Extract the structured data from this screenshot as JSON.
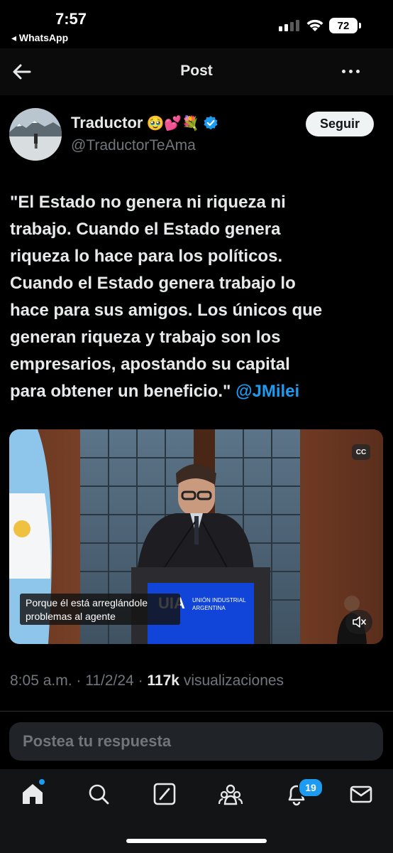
{
  "status_bar": {
    "time": "7:57",
    "back_app": "◂ WhatsApp",
    "battery": "72"
  },
  "header": {
    "title": "Post"
  },
  "author": {
    "name": "Traductor",
    "emojis": "🥹💕💐",
    "handle": "@TraductorTeAma",
    "verified": true,
    "follow_label": "Seguir"
  },
  "tweet": {
    "text": "\"El Estado no genera ni riqueza ni\ntrabajo. Cuando el Estado genera\nriqueza lo hace para los políticos.\nCuando el Estado genera trabajo lo\nhace para sus amigos. Los únicos que\ngeneran riqueza y trabajo son los\nempresarios, apostando su capital\npara obtener un beneficio.\" ",
    "mention": "@JMilei"
  },
  "media": {
    "cc_label": "CC",
    "subtitle": "Porque él está arreglándole\nproblemas al agente",
    "podium_title": "UNIÓN INDUSTRIAL",
    "podium_subtitle": "ARGENTINA",
    "podium_logo": "UIA"
  },
  "meta": {
    "time": "8:05 a.m.",
    "sep1": " · ",
    "date": "11/2/24",
    "sep2": " · ",
    "views": "117k",
    "views_label": " visualizaciones"
  },
  "reply": {
    "placeholder": "Postea tu respuesta"
  },
  "nav": {
    "items": [
      "home-icon",
      "search-icon",
      "compose-icon",
      "communities-icon",
      "notifications-icon",
      "messages-icon"
    ],
    "notifications_badge": "19"
  },
  "colors": {
    "accent": "#1d9bf0",
    "background": "#000000",
    "muted": "#71767b"
  }
}
